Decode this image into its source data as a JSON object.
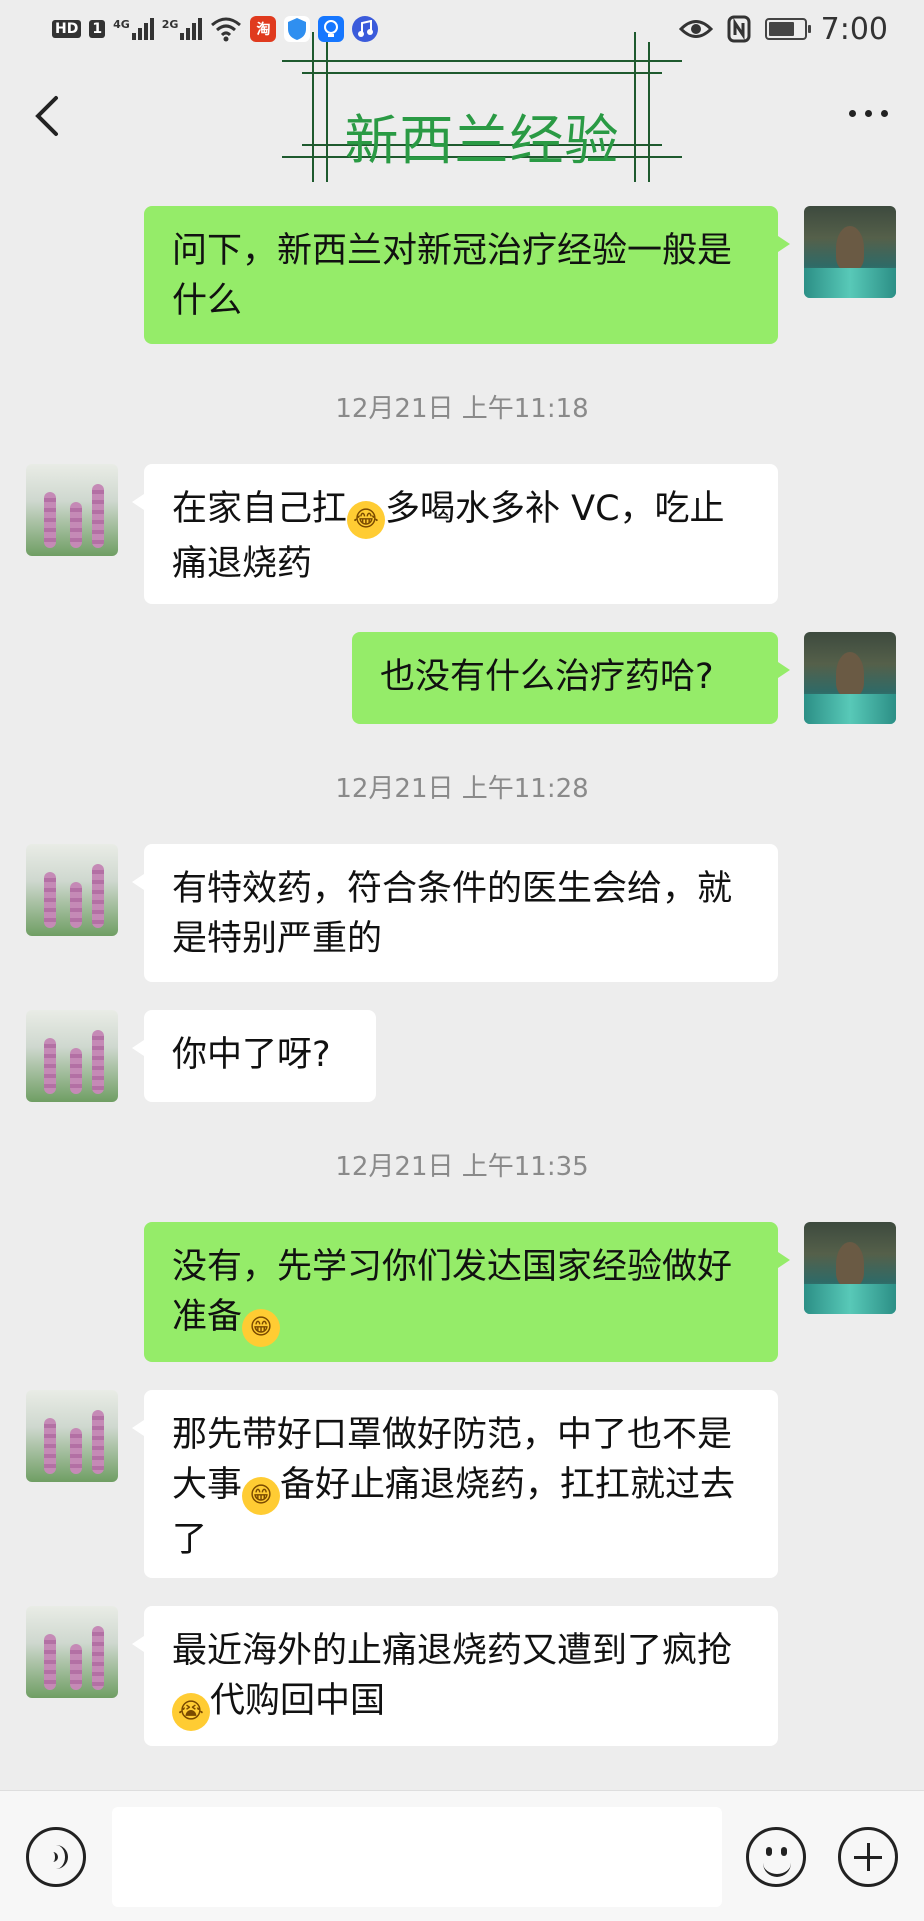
{
  "status_bar": {
    "hd": "HD",
    "sim": "1",
    "net1": "4G",
    "net2": "2G",
    "app_taobao": "淘",
    "time": "7:00",
    "battery_level": 0.75
  },
  "header": {
    "title": "新西兰经验"
  },
  "messages": [
    {
      "side": "me",
      "text": "问下，新西兰对新冠治疗经验一般是什么"
    },
    {
      "type": "time",
      "text": "12月21日 上午11:18"
    },
    {
      "side": "other",
      "text_before": "在家自己扛",
      "emoji": "laugh-cry",
      "text_after": "多喝水多补 VC，吃止痛退烧药"
    },
    {
      "side": "me",
      "text": "也没有什么治疗药哈?"
    },
    {
      "type": "time",
      "text": "12月21日 上午11:28"
    },
    {
      "side": "other",
      "text": "有特效药，符合条件的医生会给，就是特别严重的"
    },
    {
      "side": "other",
      "text": "你中了呀?"
    },
    {
      "type": "time",
      "text": "12月21日 上午11:35"
    },
    {
      "side": "me",
      "text_before": "没有，先学习你们发达国家经验做好准备",
      "emoji": "grin"
    },
    {
      "side": "other",
      "text_before": "那先带好口罩做好防范，中了也不是大事",
      "emoji": "grin",
      "text_after": "备好止痛退烧药，扛扛就过去了"
    },
    {
      "side": "other",
      "text_before": "最近海外的止痛退烧药又遭到了疯抢",
      "emoji": "crying",
      "text_after": "代购回中国"
    }
  ],
  "colors": {
    "my_bubble": "#95ec69",
    "other_bubble": "#ffffff",
    "background": "#ededed",
    "title_green": "#2a9a44"
  }
}
